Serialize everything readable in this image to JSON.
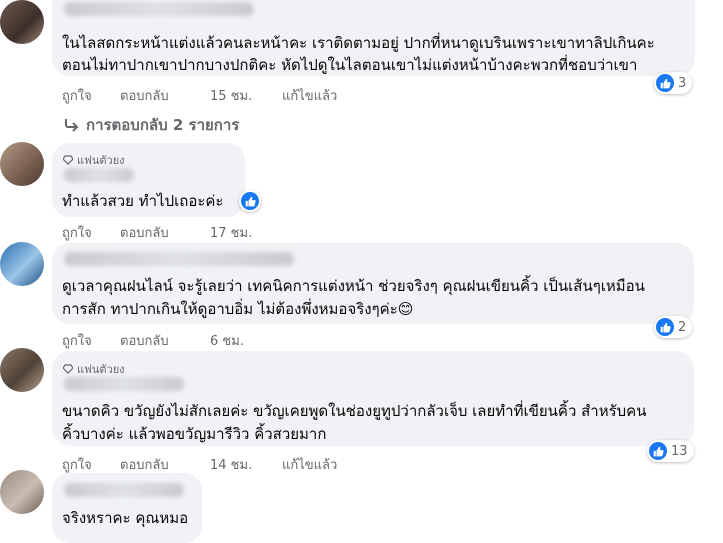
{
  "comments": [
    {
      "lines": [
        "ในไลสดกระหน้าแต่งแล้วคนละหน้าคะ เราติดตามอยู่ ปากที่หนาดูเบรินเพราะเขาทาลิปเกินคะ",
        "ตอนไม่ทาปากเขาปากบางปกติคะ หัดไปดูในไลตอนเขาไม่แต่งหน้าบ้างคะพวกที่ชอบว่าเขา"
      ],
      "likes": "3",
      "actions": {
        "like": "ถูกใจ",
        "reply": "ตอบกลับ",
        "time": "15 ชม.",
        "edited": "แก้ไขแล้ว"
      }
    },
    {
      "badge": "แฟนตัวยง",
      "lines": [
        "ทำแล้วสวย ทำไปเถอะค่ะ"
      ],
      "actions": {
        "like": "ถูกใจ",
        "reply": "ตอบกลับ",
        "time": "17 ชม."
      }
    },
    {
      "lines": [
        "ดูเวลาคุณฝนไลน์ จะรู้เลยว่า เทคนิคการแต่งหน้า ช่วยจริงๆ คุณฝนเขียนคิ้ว เป็นเส้นๆเหมือน",
        "การสัก ทาปากเกินให้ดูอาบอิ่ม ไม่ต้องพึ่งหมอจริงๆค่ะ😊"
      ],
      "likes": "2",
      "actions": {
        "like": "ถูกใจ",
        "reply": "ตอบกลับ",
        "time": "6 ชม."
      }
    },
    {
      "badge": "แฟนตัวยง",
      "lines": [
        "ขนาดคิว ขวัญยังไม่สักเลยค่ะ ขวัญเคยพูดในช่องยูทูปว่ากลัวเจ็บ เลยทำที่เขียนคิ้ว สำหรับคน",
        "คิ้วบางค่ะ แล้วพอขวัญมารีวิว คิ้วสวยมาก"
      ],
      "likes": "13",
      "actions": {
        "like": "ถูกใจ",
        "reply": "ตอบกลับ",
        "time": "14 ชม.",
        "edited": "แก้ไขแล้ว"
      }
    },
    {
      "lines": [
        "จริงหราคะ คุณหมอ"
      ]
    }
  ],
  "replies_link": "การตอบกลับ 2 รายการ",
  "colors": {
    "like_blue": "#1877f2",
    "bubble": "#f0f2f5",
    "meta": "#65676b"
  },
  "icons": {
    "like": "thumbs-up-icon",
    "reply_arrow": "reply-arrow-icon",
    "badge": "diamond-icon"
  }
}
